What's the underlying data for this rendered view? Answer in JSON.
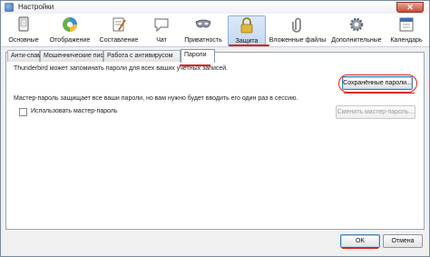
{
  "window": {
    "title": "Настройки",
    "close_glyph": "✕"
  },
  "toolbar": {
    "items": [
      {
        "label": "Основные",
        "icon": "monitor-icon"
      },
      {
        "label": "Отображение",
        "icon": "palette-icon"
      },
      {
        "label": "Составление",
        "icon": "compose-icon"
      },
      {
        "label": "Чат",
        "icon": "chat-icon"
      },
      {
        "label": "Приватность",
        "icon": "mask-icon"
      },
      {
        "label": "Защита",
        "icon": "lock-icon"
      },
      {
        "label": "Вложенные файлы",
        "icon": "paperclip-icon"
      },
      {
        "label": "Дополнительные",
        "icon": "gear-icon"
      },
      {
        "label": "Календарь",
        "icon": "calendar-icon"
      }
    ],
    "active_index": 5
  },
  "tabs": {
    "items": [
      "Анти-спам",
      "Мошеннические письма",
      "Работа с антивирусом",
      "Пароли"
    ],
    "active_index": 3
  },
  "content": {
    "remember_text": "Thunderbird может запоминать пароли для всех ваших учетных записей.",
    "saved_passwords_button": "Сохранённые пароли...",
    "master_password_text": "Мастер-пароль защищает все ваши пароли, но вам нужно будет вводить его один раз в сессию.",
    "use_master_password_label": "Использовать мастер-пароль",
    "use_master_password_checked": false,
    "change_master_password_button": "Сменить мастер-пароль..."
  },
  "footer": {
    "ok_label": "OK",
    "cancel_label": "Отмена"
  },
  "colors": {
    "annotation_red": "#e0201a",
    "active_tab_bg": "#c3d8f0"
  }
}
